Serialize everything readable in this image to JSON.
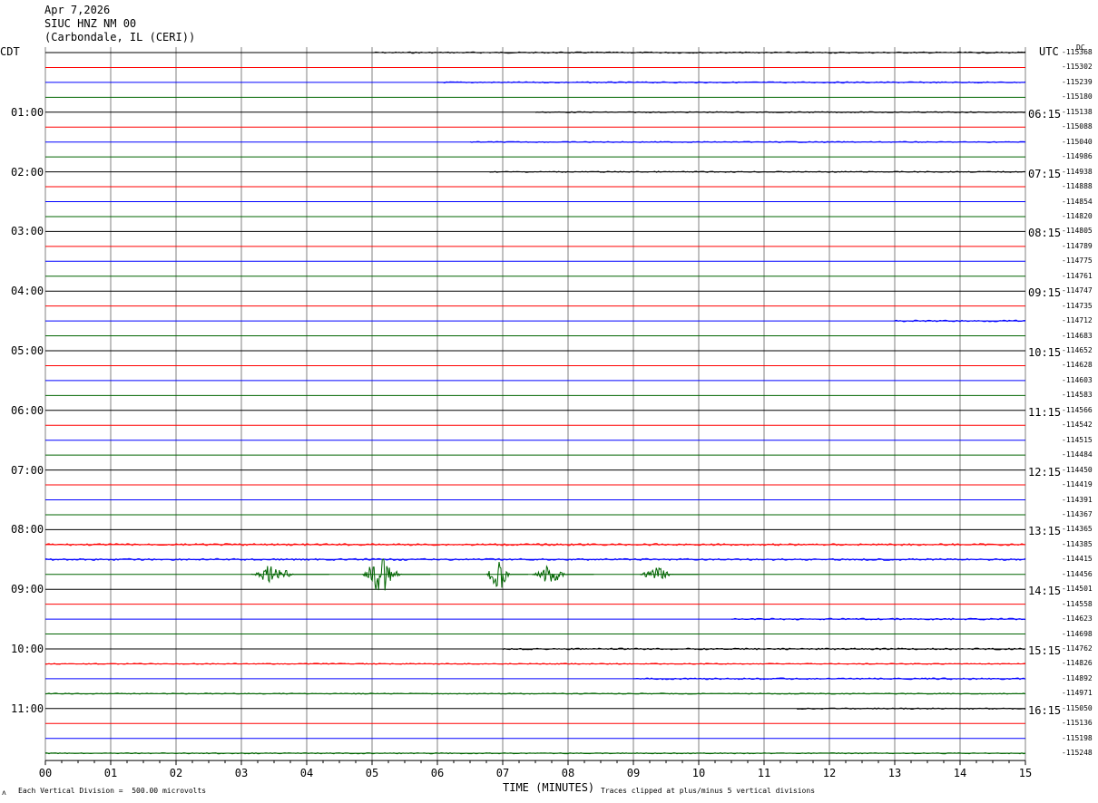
{
  "header": {
    "date": "Apr 7,2026",
    "station": "SIUC HNZ NM 00",
    "location": "(Carbondale, IL (CERI))"
  },
  "axes": {
    "left_title": "CDT",
    "right_title": "UTC",
    "dc_label": "DC",
    "x_title": "TIME (MINUTES)"
  },
  "footer": {
    "scale_note": "Each Vertical Division =  500.00 microvolts",
    "clip_note": "Traces clipped at plus/minus 5 vertical divisions",
    "corner_mark": "ᴧ"
  },
  "colors": {
    "trace_cycle": [
      "#000000",
      "#ff0000",
      "#0000ff",
      "#006400"
    ],
    "grid": "#808080"
  },
  "chart_data": {
    "type": "line",
    "title": "SIUC HNZ NM 00",
    "xlabel": "TIME (MINUTES)",
    "xlim": [
      0,
      15
    ],
    "x_ticks": [
      "00",
      "01",
      "02",
      "03",
      "04",
      "05",
      "06",
      "07",
      "08",
      "09",
      "10",
      "11",
      "12",
      "13",
      "14",
      "15"
    ],
    "row_minutes": 15,
    "left_hour_labels": [
      {
        "row": 4,
        "text": "01:00"
      },
      {
        "row": 8,
        "text": "02:00"
      },
      {
        "row": 12,
        "text": "03:00"
      },
      {
        "row": 16,
        "text": "04:00"
      },
      {
        "row": 20,
        "text": "05:00"
      },
      {
        "row": 24,
        "text": "06:00"
      },
      {
        "row": 28,
        "text": "07:00"
      },
      {
        "row": 32,
        "text": "08:00"
      },
      {
        "row": 36,
        "text": "09:00"
      },
      {
        "row": 40,
        "text": "10:00"
      },
      {
        "row": 44,
        "text": "11:00"
      }
    ],
    "right_hour_labels": [
      {
        "row": 4,
        "text": "06:15"
      },
      {
        "row": 8,
        "text": "07:15"
      },
      {
        "row": 12,
        "text": "08:15"
      },
      {
        "row": 16,
        "text": "09:15"
      },
      {
        "row": 20,
        "text": "10:15"
      },
      {
        "row": 24,
        "text": "11:15"
      },
      {
        "row": 28,
        "text": "12:15"
      },
      {
        "row": 32,
        "text": "13:15"
      },
      {
        "row": 36,
        "text": "14:15"
      },
      {
        "row": 40,
        "text": "15:15"
      },
      {
        "row": 44,
        "text": "16:15"
      }
    ],
    "dc_offsets": [
      "-115368",
      "-115302",
      "-115239",
      "-115180",
      "-115138",
      "-115088",
      "-115040",
      "-114986",
      "-114938",
      "-114888",
      "-114854",
      "-114820",
      "-114805",
      "-114789",
      "-114775",
      "-114761",
      "-114747",
      "-114735",
      "-114712",
      "-114683",
      "-114652",
      "-114628",
      "-114603",
      "-114583",
      "-114566",
      "-114542",
      "-114515",
      "-114484",
      "-114450",
      "-114419",
      "-114391",
      "-114367",
      "-114365",
      "-114385",
      "-114415",
      "-114456",
      "-114501",
      "-114558",
      "-114623",
      "-114698",
      "-114762",
      "-114826",
      "-114892",
      "-114971",
      "-115050",
      "-115136",
      "-115198",
      "-115248"
    ],
    "noise_rows": [
      {
        "row": 0,
        "start": 5.0,
        "level": 0.25
      },
      {
        "row": 2,
        "start": 6.0,
        "level": 0.25
      },
      {
        "row": 4,
        "start": 7.5,
        "level": 0.2
      },
      {
        "row": 6,
        "start": 6.5,
        "level": 0.2
      },
      {
        "row": 8,
        "start": 6.8,
        "level": 0.2
      },
      {
        "row": 18,
        "start": 13.0,
        "level": 0.3
      },
      {
        "row": 33,
        "start": 0.0,
        "level": 0.35
      },
      {
        "row": 34,
        "start": 0.0,
        "level": 0.35
      },
      {
        "row": 38,
        "start": 10.5,
        "level": 0.3
      },
      {
        "row": 40,
        "start": 7.0,
        "level": 0.3
      },
      {
        "row": 42,
        "start": 9.0,
        "level": 0.3
      },
      {
        "row": 44,
        "start": 11.5,
        "level": 0.25
      },
      {
        "row": 41,
        "start": 0.0,
        "level": 0.2
      },
      {
        "row": 43,
        "start": 0.0,
        "level": 0.2
      },
      {
        "row": 47,
        "start": 0.0,
        "level": 0.2
      }
    ],
    "events": [
      {
        "row": 35,
        "start": 3.15,
        "end": 4.35,
        "peak": 11
      },
      {
        "row": 35,
        "start": 4.85,
        "end": 5.9,
        "peak": 22
      },
      {
        "row": 35,
        "start": 6.75,
        "end": 7.4,
        "peak": 18
      },
      {
        "row": 35,
        "start": 7.45,
        "end": 8.4,
        "peak": 10
      },
      {
        "row": 35,
        "start": 9.1,
        "end": 10.0,
        "peak": 8
      }
    ]
  }
}
